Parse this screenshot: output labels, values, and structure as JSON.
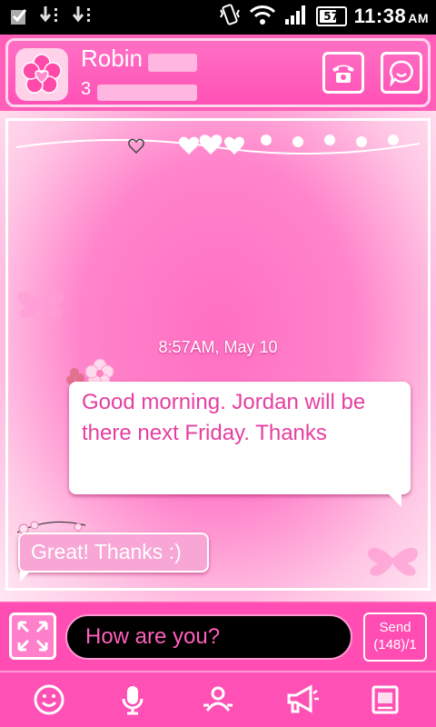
{
  "status_bar": {
    "time": "11:38",
    "ampm": "AM",
    "battery_level": "57",
    "icons": [
      "checkbox-icon",
      "usb-download-icon",
      "usb-download-icon",
      "vibrate-icon",
      "wifi-icon",
      "signal-icon",
      "battery-icon"
    ]
  },
  "header": {
    "name": "Robin",
    "number": "3",
    "buttons": [
      "phone-icon",
      "emoticon-icon"
    ]
  },
  "conversation": {
    "timestamp": "8:57AM, May 10",
    "messages": [
      {
        "direction": "incoming",
        "text": "Good morning.  Jordan will be there next Friday. Thanks"
      },
      {
        "direction": "outgoing",
        "text": "Great! Thanks :)"
      }
    ]
  },
  "compose": {
    "text": "How are you?",
    "send_label": "Send",
    "counter": "(148)/1"
  },
  "toolbar": {
    "icons": [
      "smiley-icon",
      "microphone-icon",
      "contact-card-icon",
      "megaphone-icon",
      "template-icon"
    ]
  },
  "colors": {
    "theme_pink": "#ff5fb8",
    "bubble_text": "#e63ea0",
    "status_bar": "#000000"
  }
}
